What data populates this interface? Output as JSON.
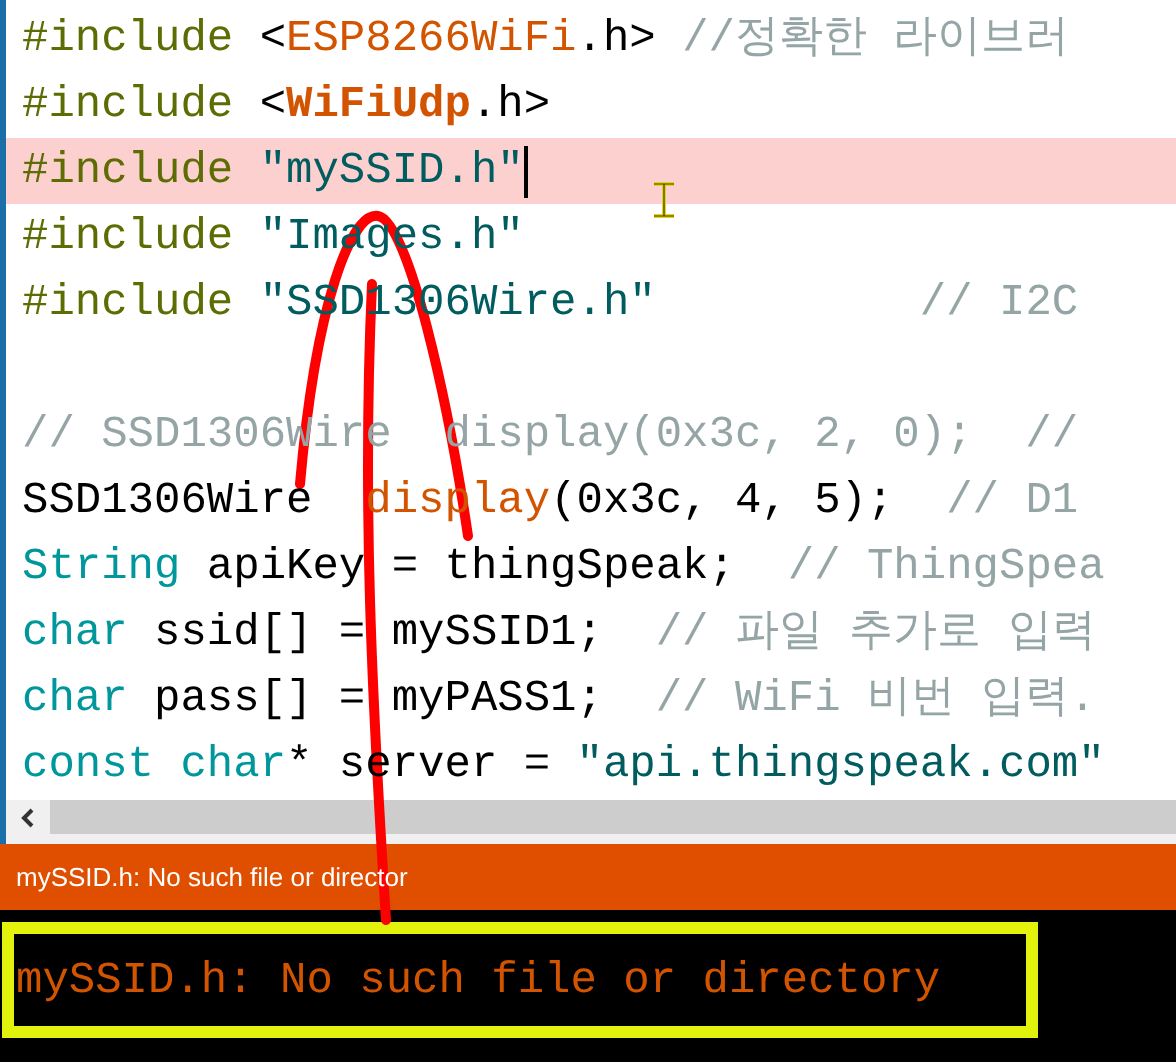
{
  "editor": {
    "lines": [
      {
        "highlighted": false,
        "cursor": false,
        "tokens": [
          {
            "kind": "directive",
            "text": "#include"
          },
          {
            "kind": "plain",
            "text": " <"
          },
          {
            "kind": "library",
            "text": "ESP8266WiFi"
          },
          {
            "kind": "plain",
            "text": ".h> "
          },
          {
            "kind": "comment",
            "text": "//정확한 라이브러"
          }
        ]
      },
      {
        "highlighted": false,
        "cursor": false,
        "tokens": [
          {
            "kind": "directive",
            "text": "#include"
          },
          {
            "kind": "plain",
            "text": " <"
          },
          {
            "kind": "library-bold",
            "text": "WiFiUdp"
          },
          {
            "kind": "plain",
            "text": ".h>"
          }
        ]
      },
      {
        "highlighted": true,
        "cursor": true,
        "tokens": [
          {
            "kind": "directive",
            "text": "#include "
          },
          {
            "kind": "string",
            "text": "\"mySSID.h\""
          }
        ]
      },
      {
        "highlighted": false,
        "cursor": false,
        "tokens": [
          {
            "kind": "directive",
            "text": "#include "
          },
          {
            "kind": "string",
            "text": "\"Images.h\""
          }
        ]
      },
      {
        "highlighted": false,
        "cursor": false,
        "tokens": [
          {
            "kind": "directive",
            "text": "#include "
          },
          {
            "kind": "string",
            "text": "\"SSD1306Wire.h\""
          },
          {
            "kind": "comment",
            "text": "          // I2C"
          }
        ]
      },
      {
        "highlighted": false,
        "cursor": false
      },
      {
        "highlighted": false,
        "cursor": false,
        "tokens": [
          {
            "kind": "comment",
            "text": "// SSD1306Wire  display(0x3c, 2, 0);  //"
          }
        ]
      },
      {
        "highlighted": false,
        "cursor": false,
        "tokens": [
          {
            "kind": "plain",
            "text": "SSD1306Wire  "
          },
          {
            "kind": "library",
            "text": "display"
          },
          {
            "kind": "plain",
            "text": "(0x3c, 4, 5);  "
          },
          {
            "kind": "comment",
            "text": "// D1"
          }
        ]
      },
      {
        "highlighted": false,
        "cursor": false,
        "tokens": [
          {
            "kind": "type",
            "text": "String"
          },
          {
            "kind": "plain",
            "text": " apiKey = thingSpeak;  "
          },
          {
            "kind": "comment",
            "text": "// ThingSpea"
          }
        ]
      },
      {
        "highlighted": false,
        "cursor": false,
        "tokens": [
          {
            "kind": "type",
            "text": "char"
          },
          {
            "kind": "plain",
            "text": " ssid[] = mySSID1;  "
          },
          {
            "kind": "comment",
            "text": "// 파일 추가로 입력"
          }
        ]
      },
      {
        "highlighted": false,
        "cursor": false,
        "tokens": [
          {
            "kind": "type",
            "text": "char"
          },
          {
            "kind": "plain",
            "text": " pass[] = myPASS1;  "
          },
          {
            "kind": "comment",
            "text": "// WiFi 비번 입력."
          }
        ]
      },
      {
        "highlighted": false,
        "cursor": false,
        "tokens": [
          {
            "kind": "type",
            "text": "const char"
          },
          {
            "kind": "plain",
            "text": "* server = "
          },
          {
            "kind": "string",
            "text": "\"api.thingspeak.com\""
          }
        ]
      }
    ]
  },
  "status_bar": {
    "message": "mySSID.h: No such file or director"
  },
  "console": {
    "lines": [
      "mySSID.h: No such file or directory"
    ]
  }
}
